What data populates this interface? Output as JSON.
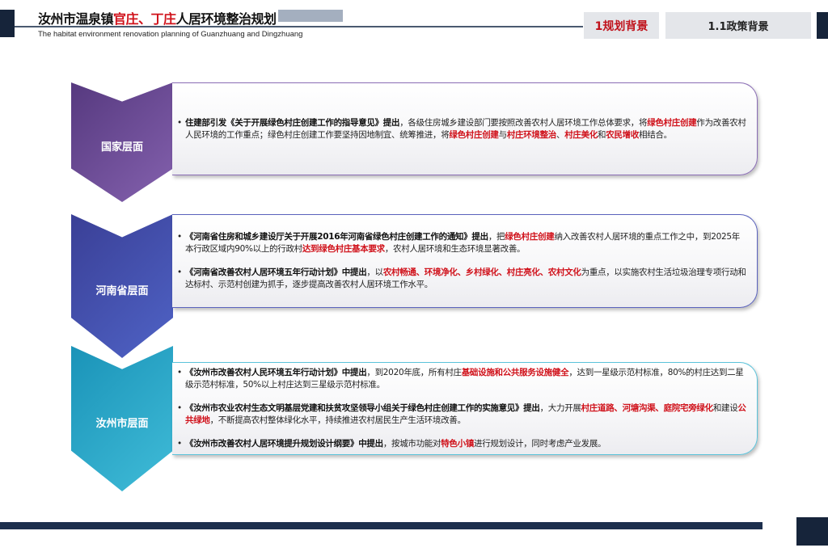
{
  "header": {
    "title": [
      {
        "t": "汝州市温泉镇",
        "s": ""
      },
      {
        "t": "官庄、丁庄",
        "s": "r"
      },
      {
        "t": "人居环境整治规划",
        "s": ""
      }
    ],
    "subtitle": "The habitat environment renovation planning of Guanzhuang and Dingzhuang",
    "tab_section": "1规划背景",
    "tab_subsection": "1.1政策背景"
  },
  "colors": {
    "accent_red": "#d0121b",
    "navy": "#16243a"
  },
  "levels": [
    {
      "label": "国家层面",
      "items": [
        [
          {
            "t": "住建部引发《关于开展绿色村庄创建工作的指导意见》提出",
            "s": "b"
          },
          {
            "t": "，各级住房城乡建设部门要按照改善农村人居环境工作总体要求，将",
            "s": ""
          },
          {
            "t": "绿色村庄创建",
            "s": "r"
          },
          {
            "t": "作为改善农村人民环境的工作重点；绿色村庄创建工作要坚持因地制宜、统筹推进，将",
            "s": ""
          },
          {
            "t": "绿色村庄创建",
            "s": "r"
          },
          {
            "t": "与",
            "s": ""
          },
          {
            "t": "村庄环境整治",
            "s": "r"
          },
          {
            "t": "、",
            "s": ""
          },
          {
            "t": "村庄美化",
            "s": "r"
          },
          {
            "t": "和",
            "s": ""
          },
          {
            "t": "农民增收",
            "s": "r"
          },
          {
            "t": "相结合。",
            "s": ""
          }
        ]
      ]
    },
    {
      "label": "河南省层面",
      "items": [
        [
          {
            "t": "《河南省住房和城乡建设厅关于开展2016年河南省绿色村庄创建工作的通知》提出",
            "s": "b"
          },
          {
            "t": "，把",
            "s": ""
          },
          {
            "t": "绿色村庄创建",
            "s": "r"
          },
          {
            "t": "纳入改善农村人居环境的重点工作之中，到2025年本行政区域内90%以上的行政村",
            "s": ""
          },
          {
            "t": "达到绿色村庄基本要求",
            "s": "r"
          },
          {
            "t": "，农村人居环境和生态环境显著改善。",
            "s": ""
          }
        ],
        [
          {
            "t": "《河南省改善农村人居环境五年行动计划》中提出",
            "s": "b"
          },
          {
            "t": "，以",
            "s": ""
          },
          {
            "t": "农村畅通、环境净化、乡村绿化、村庄亮化、农村文化",
            "s": "r"
          },
          {
            "t": "为重点，以实施农村生活垃圾治理专项行动和达标村、示范村创建为抓手，逐步提高改善农村人居环境工作水平。",
            "s": ""
          }
        ]
      ]
    },
    {
      "label": "汝州市层面",
      "items": [
        [
          {
            "t": "《汝州市改善农村人民环境五年行动计划》中提出",
            "s": "b"
          },
          {
            "t": "，到2020年底，所有村庄",
            "s": ""
          },
          {
            "t": "基础设施和公共服务设施健全",
            "s": "r"
          },
          {
            "t": "，达到一星级示范村标准，80%的村庄达到二星级示范村标准，50%以上村庄达到三星级示范村标准。",
            "s": ""
          }
        ],
        [
          {
            "t": "《汝州市农业农村生态文明基层党建和扶贫攻坚领导小组关于绿色村庄创建工作的实施意见》提出",
            "s": "b"
          },
          {
            "t": "，大力开展",
            "s": ""
          },
          {
            "t": "村庄道路、河塘沟渠、庭院宅旁绿化",
            "s": "r"
          },
          {
            "t": "和建设",
            "s": ""
          },
          {
            "t": "公共绿地",
            "s": "r"
          },
          {
            "t": "，不断提高农村整体绿化水平，持续推进农村居民生产生活环境改善。",
            "s": ""
          }
        ],
        [
          {
            "t": "《汝州市改善农村人居环境提升规划设计纲要》中提出",
            "s": "b"
          },
          {
            "t": "，按城市功能对",
            "s": ""
          },
          {
            "t": "特色小镇",
            "s": "r"
          },
          {
            "t": "进行规划设计，同时考虑产业发展。",
            "s": ""
          }
        ]
      ]
    }
  ]
}
